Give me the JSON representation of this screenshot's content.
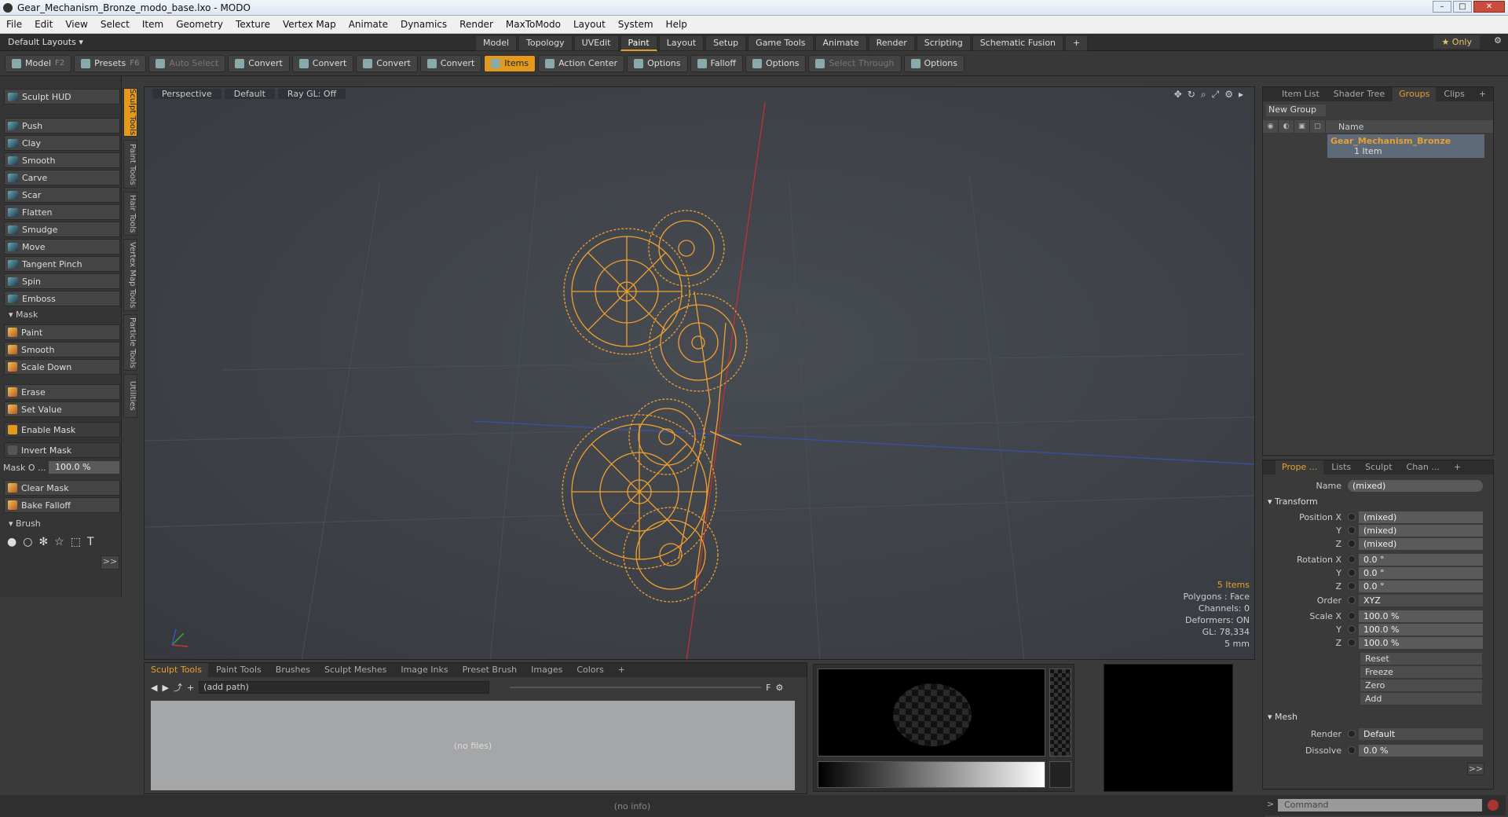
{
  "window": {
    "title": "Gear_Mechanism_Bronze_modo_base.lxo - MODO"
  },
  "menu": [
    "File",
    "Edit",
    "View",
    "Select",
    "Item",
    "Geometry",
    "Texture",
    "Vertex Map",
    "Animate",
    "Dynamics",
    "Render",
    "MaxToModo",
    "Layout",
    "System",
    "Help"
  ],
  "layouts": {
    "current": "Default Layouts",
    "tabs": [
      "Model",
      "Topology",
      "UVEdit",
      "Paint",
      "Layout",
      "Setup",
      "Game Tools",
      "Animate",
      "Render",
      "Scripting",
      "Schematic Fusion"
    ],
    "active": "Paint",
    "only_label": "Only"
  },
  "toolbar": {
    "model": "Model",
    "model_key": "F2",
    "presets": "Presets",
    "presets_key": "F6",
    "auto_select": "Auto Select",
    "convert": "Convert",
    "items": "Items",
    "action_center": "Action Center",
    "options": "Options",
    "falloff": "Falloff",
    "select_through": "Select Through"
  },
  "left": {
    "sculpt_hud": "Sculpt HUD",
    "tools": [
      "Push",
      "Clay",
      "Smooth",
      "Carve",
      "Scar",
      "Flatten",
      "Smudge",
      "Move",
      "Tangent Pinch",
      "Spin",
      "Emboss"
    ],
    "mask_section": "Mask",
    "mask_tools": [
      "Paint",
      "Smooth",
      "Scale Down"
    ],
    "erase": "Erase",
    "set_value": "Set Value",
    "enable_mask": "Enable Mask",
    "invert_mask": "Invert Mask",
    "mask_opacity_label": "Mask O ...",
    "mask_opacity_value": "100.0 %",
    "clear_mask": "Clear Mask",
    "bake_falloff": "Bake Falloff",
    "brush_section": "Brush",
    "more": ">>"
  },
  "vtabs": [
    "Sculpt Tools",
    "Paint Tools",
    "Hair Tools",
    "Vertex Map Tools",
    "Particle Tools",
    "Utilities"
  ],
  "viewport": {
    "view": "Perspective",
    "shading": "Default",
    "raygl": "Ray GL: Off",
    "info": {
      "items": "5 Items",
      "polygons": "Polygons : Face",
      "channels": "Channels: 0",
      "deformers": "Deformers: ON",
      "gl": "GL: 78,334",
      "scale": "5 mm"
    }
  },
  "bottom": {
    "tabs": [
      "Sculpt Tools",
      "Paint Tools",
      "Brushes",
      "Sculpt Meshes",
      "Image Inks",
      "Preset Brush",
      "Images",
      "Colors"
    ],
    "path": "(add path)",
    "no_files": "(no files)",
    "status": "(no info)"
  },
  "right_top": {
    "tabs": [
      "Item List",
      "Shader Tree",
      "Groups",
      "Clips"
    ],
    "active": "Groups",
    "new_group": "New Group",
    "col_name": "Name",
    "group_name": "Gear_Mechanism_Bronze",
    "group_sub": "1 Item"
  },
  "right_bottom": {
    "tabs": [
      "Prope ...",
      "Lists",
      "Sculpt",
      "Chan ..."
    ],
    "name_label": "Name",
    "name_value": "(mixed)",
    "transform": "Transform",
    "pos_x_label": "Position X",
    "pos_x": "(mixed)",
    "pos_y_label": "Y",
    "pos_y": "(mixed)",
    "pos_z_label": "Z",
    "pos_z": "(mixed)",
    "rot_x_label": "Rotation X",
    "rot_x": "0.0 °",
    "rot_y_label": "Y",
    "rot_y": "0.0 °",
    "rot_z_label": "Z",
    "rot_z": "0.0 °",
    "order_label": "Order",
    "order": "XYZ",
    "scale_x_label": "Scale X",
    "scale_x": "100.0 %",
    "scale_y_label": "Y",
    "scale_y": "100.0 %",
    "scale_z_label": "Z",
    "scale_z": "100.0 %",
    "reset": "Reset",
    "freeze": "Freeze",
    "zero": "Zero",
    "add": "Add",
    "mesh": "Mesh",
    "render_label": "Render",
    "render": "Default",
    "dissolve_label": "Dissolve",
    "dissolve": "0.0 %",
    "more": ">>"
  },
  "command": {
    "placeholder": "Command"
  },
  "colors": {
    "accent": "#e39a1c",
    "wire": "#f0a030"
  }
}
